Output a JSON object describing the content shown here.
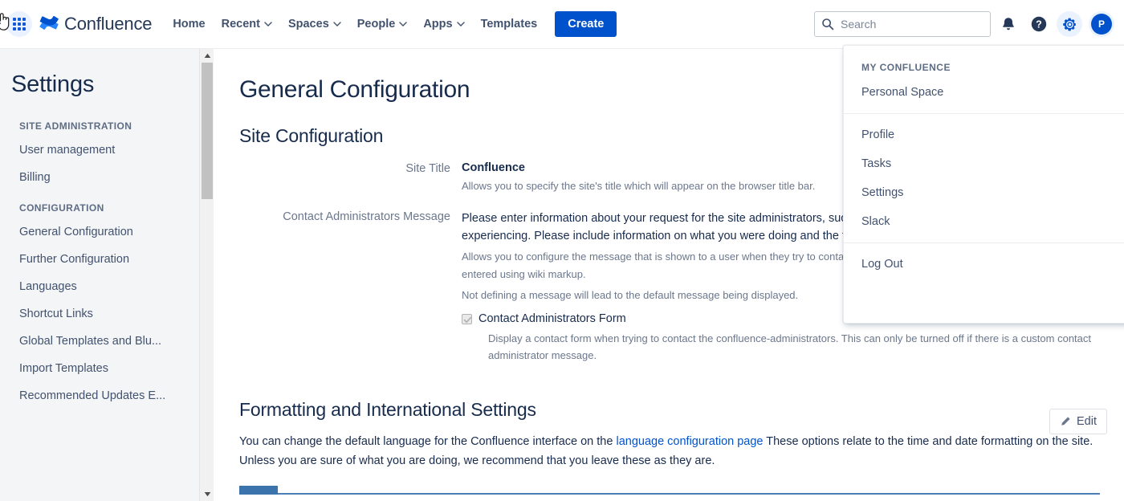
{
  "topnav": {
    "app_switcher_label": "App switcher",
    "brand": "Confluence",
    "links": [
      {
        "label": "Home",
        "has_chevron": false
      },
      {
        "label": "Recent",
        "has_chevron": true
      },
      {
        "label": "Spaces",
        "has_chevron": true
      },
      {
        "label": "People",
        "has_chevron": true
      },
      {
        "label": "Apps",
        "has_chevron": true
      },
      {
        "label": "Templates",
        "has_chevron": false
      }
    ],
    "create_label": "Create",
    "search_placeholder": "Search",
    "search_value": "",
    "icons": [
      "notifications-icon",
      "help-icon",
      "settings-gear-icon"
    ],
    "avatar_initial": "P"
  },
  "sidebar": {
    "title": "Settings",
    "groups": [
      {
        "heading": "SITE ADMINISTRATION",
        "items": [
          {
            "label": "User management"
          },
          {
            "label": "Billing"
          }
        ]
      },
      {
        "heading": "CONFIGURATION",
        "items": [
          {
            "label": "General Configuration"
          },
          {
            "label": "Further Configuration"
          },
          {
            "label": "Languages"
          },
          {
            "label": "Shortcut Links"
          },
          {
            "label": "Global Templates and Blu..."
          },
          {
            "label": "Import Templates"
          },
          {
            "label": "Recommended Updates E..."
          }
        ]
      }
    ]
  },
  "main": {
    "page_title": "General Configuration",
    "site_configuration": {
      "heading": "Site Configuration",
      "rows": [
        {
          "label": "Site Title",
          "value": "Confluence",
          "bold": true,
          "hint": "Allows you to specify the site's title which will appear on the browser title bar."
        },
        {
          "label": "Contact Administrators Message",
          "value": "Please enter information about your request for the site administrators, such as a description of the problem you are experiencing. Please include information on what you were doing and the time the problem occurred.",
          "bold": false,
          "hint": "Allows you to configure the message that is shown to a user when they try to contact the site administrators. The message may be entered using wiki markup.",
          "hint2": "Not defining a message will lead to the default message being displayed."
        }
      ],
      "checkbox": {
        "label": "Contact Administrators Form",
        "checked": true,
        "description": "Display a contact form when trying to contact the confluence-administrators. This can only be turned off if there is a custom contact administrator message."
      }
    },
    "formatting": {
      "heading": "Formatting and International Settings",
      "edit_label": "Edit",
      "paragraph_before_link": "You can change the default language for the Confluence interface on the ",
      "link_text": "language configuration page",
      "paragraph_after_link": " These options relate to the time and date formatting on the site. Unless you are sure of what you are doing, we recommend that you leave these as they are."
    }
  },
  "profile_dropdown": {
    "section_heading": "MY CONFLUENCE",
    "group1": [
      {
        "label": "Personal Space"
      }
    ],
    "group2": [
      {
        "label": "Profile"
      },
      {
        "label": "Tasks"
      },
      {
        "label": "Settings"
      },
      {
        "label": "Slack"
      }
    ],
    "group3": [
      {
        "label": "Log Out"
      }
    ]
  },
  "colors": {
    "brand_blue": "#0052CC",
    "link_blue": "#0052CC",
    "sidebar_bg": "#F4F5F7",
    "text_primary": "#172B4D",
    "text_muted": "#6B778C"
  }
}
